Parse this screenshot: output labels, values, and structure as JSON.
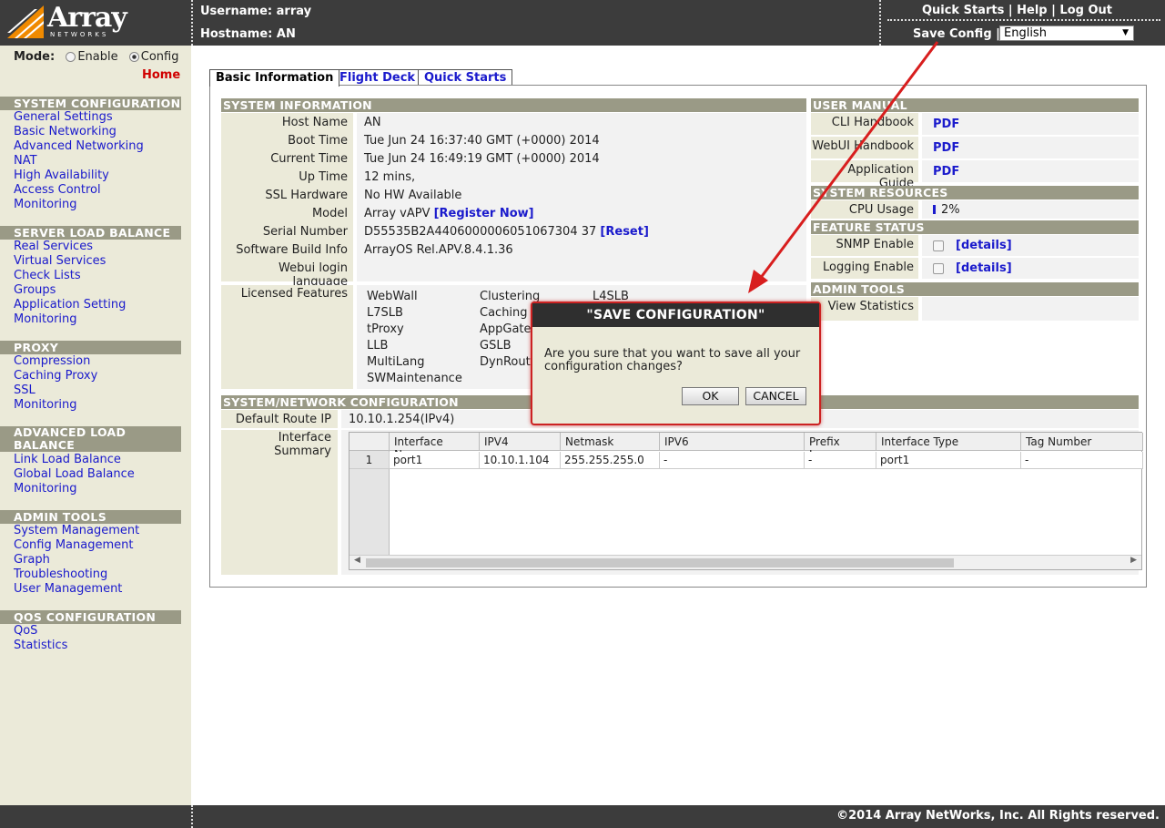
{
  "header": {
    "brand": "Array",
    "brand_sub": "NETWORKS",
    "username_label": "Username: array",
    "hostname_label": "Hostname: AN",
    "links": [
      "Quick Starts",
      "Help",
      "Log Out"
    ],
    "save_config": "Save Config",
    "language": "English"
  },
  "sidebar": {
    "mode_label": "Mode:",
    "mode_options": [
      "Enable",
      "Config"
    ],
    "mode_selected": "Config",
    "home": "Home",
    "sections": [
      {
        "title": "SYSTEM CONFIGURATION",
        "items": [
          "General Settings",
          "Basic Networking",
          "Advanced Networking",
          "NAT",
          "High Availability",
          "Access Control",
          "Monitoring"
        ]
      },
      {
        "title": "SERVER LOAD BALANCE",
        "items": [
          "Real Services",
          "Virtual Services",
          "Check Lists",
          "Groups",
          "Application Setting",
          "Monitoring"
        ]
      },
      {
        "title": "PROXY",
        "items": [
          "Compression",
          "Caching Proxy",
          "SSL",
          "Monitoring"
        ]
      },
      {
        "title": "ADVANCED LOAD BALANCE",
        "items": [
          "Link Load Balance",
          "Global Load Balance",
          "Monitoring"
        ]
      },
      {
        "title": "ADMIN TOOLS",
        "items": [
          "System Management",
          "Config Management",
          "Graph",
          "Troubleshooting",
          "User Management"
        ]
      },
      {
        "title": "QOS CONFIGURATION",
        "items": [
          "QoS",
          "Statistics"
        ]
      }
    ]
  },
  "tabs": [
    "Basic Information",
    "Flight Deck",
    "Quick Starts"
  ],
  "system_info": {
    "title": "SYSTEM INFORMATION",
    "rows": [
      {
        "label": "Host Name",
        "value": "AN"
      },
      {
        "label": "Boot Time",
        "value": "Tue Jun 24 16:37:40 GMT (+0000) 2014"
      },
      {
        "label": "Current Time",
        "value": "Tue Jun 24 16:49:19 GMT (+0000) 2014"
      },
      {
        "label": "Up Time",
        "value": "12 mins,"
      },
      {
        "label": "SSL Hardware",
        "value": "No HW Available"
      },
      {
        "label": "Model",
        "value": "Array vAPV",
        "link": "[Register Now]"
      },
      {
        "label": "Serial Number",
        "value": "D55535B2A4406000006051067304 37",
        "link": "[Reset]"
      },
      {
        "label": "Software Build Info",
        "value": "ArrayOS Rel.APV.8.4.1.36"
      },
      {
        "label": "Webui login language",
        "value": ""
      }
    ],
    "licensed_label": "Licensed Features",
    "licensed": [
      "WebWall",
      "Clustering",
      "L4SLB",
      "L7SLB",
      "Caching",
      "",
      "tProxy",
      "AppGate",
      "",
      "LLB",
      "GSLB",
      "",
      "MultiLang",
      "DynRoute",
      "",
      "SWMaintenance",
      "",
      ""
    ]
  },
  "user_manual": {
    "title": "USER MANUAL",
    "rows": [
      {
        "label": "CLI Handbook",
        "value": "PDF"
      },
      {
        "label": "WebUI Handbook",
        "value": "PDF"
      },
      {
        "label": "Application Guide",
        "value": "PDF"
      }
    ]
  },
  "system_resources": {
    "title": "SYSTEM RESOURCES",
    "cpu_label": "CPU Usage",
    "cpu_value": "2%",
    "cpu_fraction": 0.02
  },
  "feature_status": {
    "title": "FEATURE STATUS",
    "rows": [
      {
        "label": "SNMP Enable",
        "link": "[details]"
      },
      {
        "label": "Logging Enable",
        "link": "[details]"
      }
    ]
  },
  "admin_tools": {
    "title": "ADMIN TOOLS",
    "view_stats": "View Statistics"
  },
  "network": {
    "title": "SYSTEM/NETWORK CONFIGURATION",
    "default_route_label": "Default Route IP",
    "default_route_value": "10.10.1.254(IPv4)",
    "interface_label": "Interface Summary",
    "columns": [
      "Interface Name",
      "IPV4",
      "Netmask",
      "IPV6",
      "Prefix Len...",
      "Interface Type",
      "Tag Number"
    ],
    "rows": [
      [
        "1",
        "port1",
        "10.10.1.104",
        "255.255.255.0",
        "-",
        "-",
        "port1",
        "-"
      ]
    ]
  },
  "dialog": {
    "title": "\"SAVE CONFIGURATION\"",
    "message": "Are you sure that you want to save all your configuration changes?",
    "ok": "OK",
    "cancel": "CANCEL"
  },
  "footer": "©2014 Array NetWorks, Inc. All Rights reserved."
}
